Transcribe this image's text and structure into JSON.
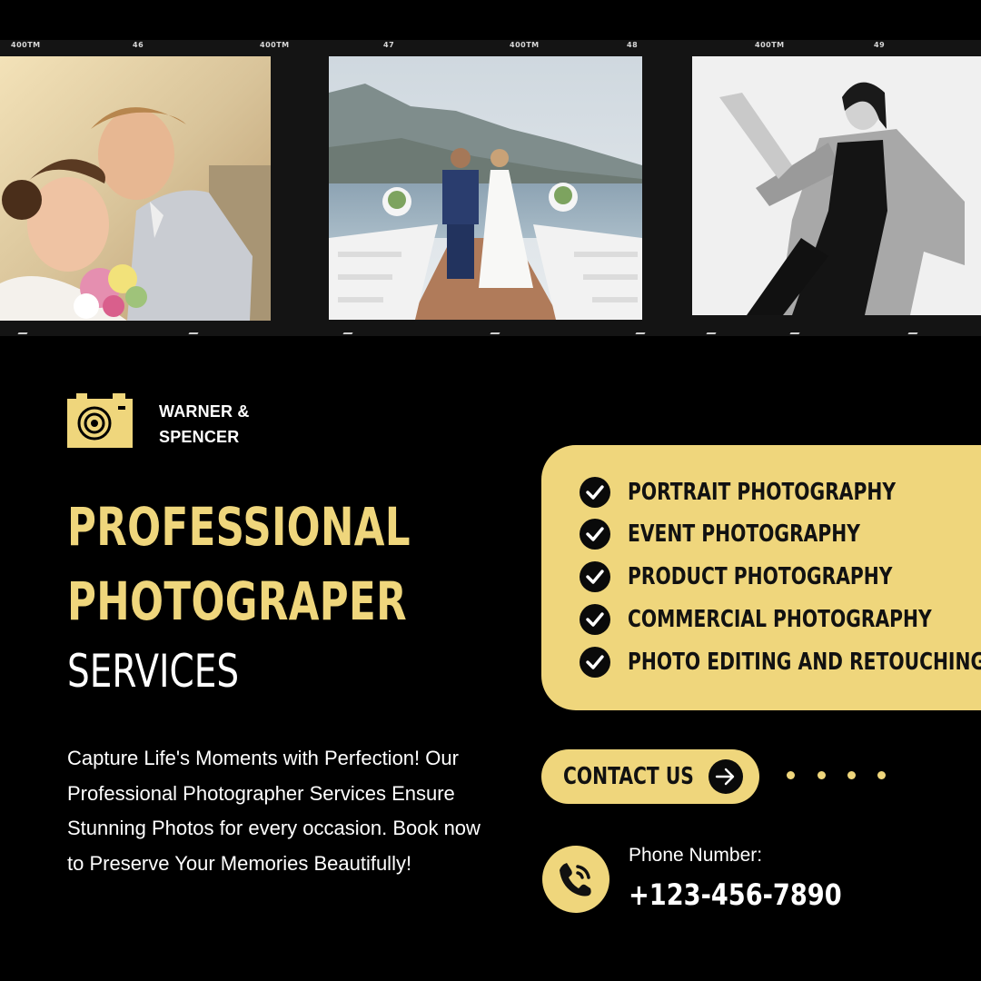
{
  "film_strip": {
    "codes": [
      "400TM",
      "46",
      "400TM",
      "47",
      "400TM",
      "48",
      "400TM",
      "49"
    ],
    "photos": [
      {
        "icon": "couple-portrait-photo"
      },
      {
        "icon": "beach-wedding-photo"
      },
      {
        "icon": "fashion-model-photo"
      }
    ]
  },
  "brand": {
    "line1": "WARNER &",
    "line2": "SPENCER",
    "icon": "camera-icon"
  },
  "headline": {
    "line1": "PROFESSIONAL",
    "line2": "PHOTOGRAPER",
    "line3": "SERVICES"
  },
  "description": "Capture Life's Moments with Perfection! Our Professional Photographer Services Ensure Stunning Photos for every occasion. Book now to Preserve Your Memories Beautifully!",
  "services": [
    {
      "label": "PORTRAIT PHOTOGRAPHY"
    },
    {
      "label": "EVENT PHOTOGRAPHY"
    },
    {
      "label": "PRODUCT PHOTOGRAPHY"
    },
    {
      "label": "COMMERCIAL PHOTOGRAPHY"
    },
    {
      "label": "PHOTO EDITING AND RETOUCHING"
    }
  ],
  "contact": {
    "button_label": "CONTACT US",
    "phone_caption": "Phone Number:",
    "phone_number": "+123-456-7890"
  },
  "colors": {
    "accent": "#EFD67C",
    "background": "#000000",
    "text": "#FFFFFF"
  }
}
